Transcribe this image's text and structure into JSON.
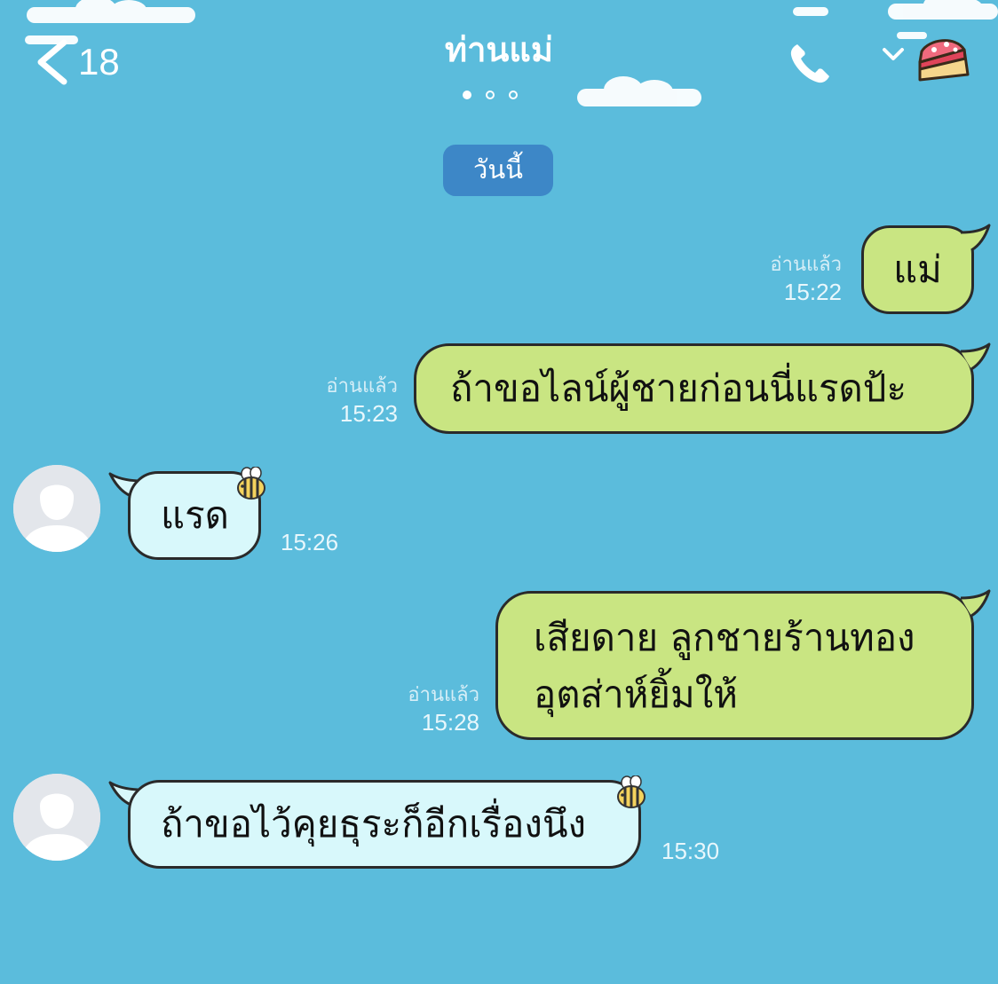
{
  "header": {
    "back_count": "18",
    "title": "ท่านแม่",
    "page_dots": 3,
    "active_dot": 0
  },
  "date_label": "วันนี้",
  "messages": [
    {
      "side": "out",
      "text": "แม่",
      "read": "อ่านแล้ว",
      "time": "15:22"
    },
    {
      "side": "out",
      "text": "ถ้าขอไลน์ผู้ชายก่อนนี่แรดป้ะ",
      "read": "อ่านแล้ว",
      "time": "15:23"
    },
    {
      "side": "in",
      "text": "แรด",
      "time": "15:26"
    },
    {
      "side": "out",
      "line1": "เสียดาย ลูกชายร้านทอง",
      "line2": "อุตส่าห์ยิ้มให้",
      "read": "อ่านแล้ว",
      "time": "15:28"
    },
    {
      "side": "in",
      "text": "ถ้าขอไว้คุยธุระก็อีกเรื่องนึง",
      "time": "15:30"
    }
  ],
  "colors": {
    "background": "#5bbcdc",
    "outgoing_bubble": "#c9e582",
    "incoming_bubble": "#d8f8fb",
    "date_chip": "#3d87c7"
  },
  "icons": {
    "back": "chevron-left-icon",
    "call": "phone-icon",
    "menu": "chevron-down-icon",
    "decoration": "cake-slice-icon",
    "sticker": "bee-icon",
    "avatar": "default-user-icon"
  }
}
